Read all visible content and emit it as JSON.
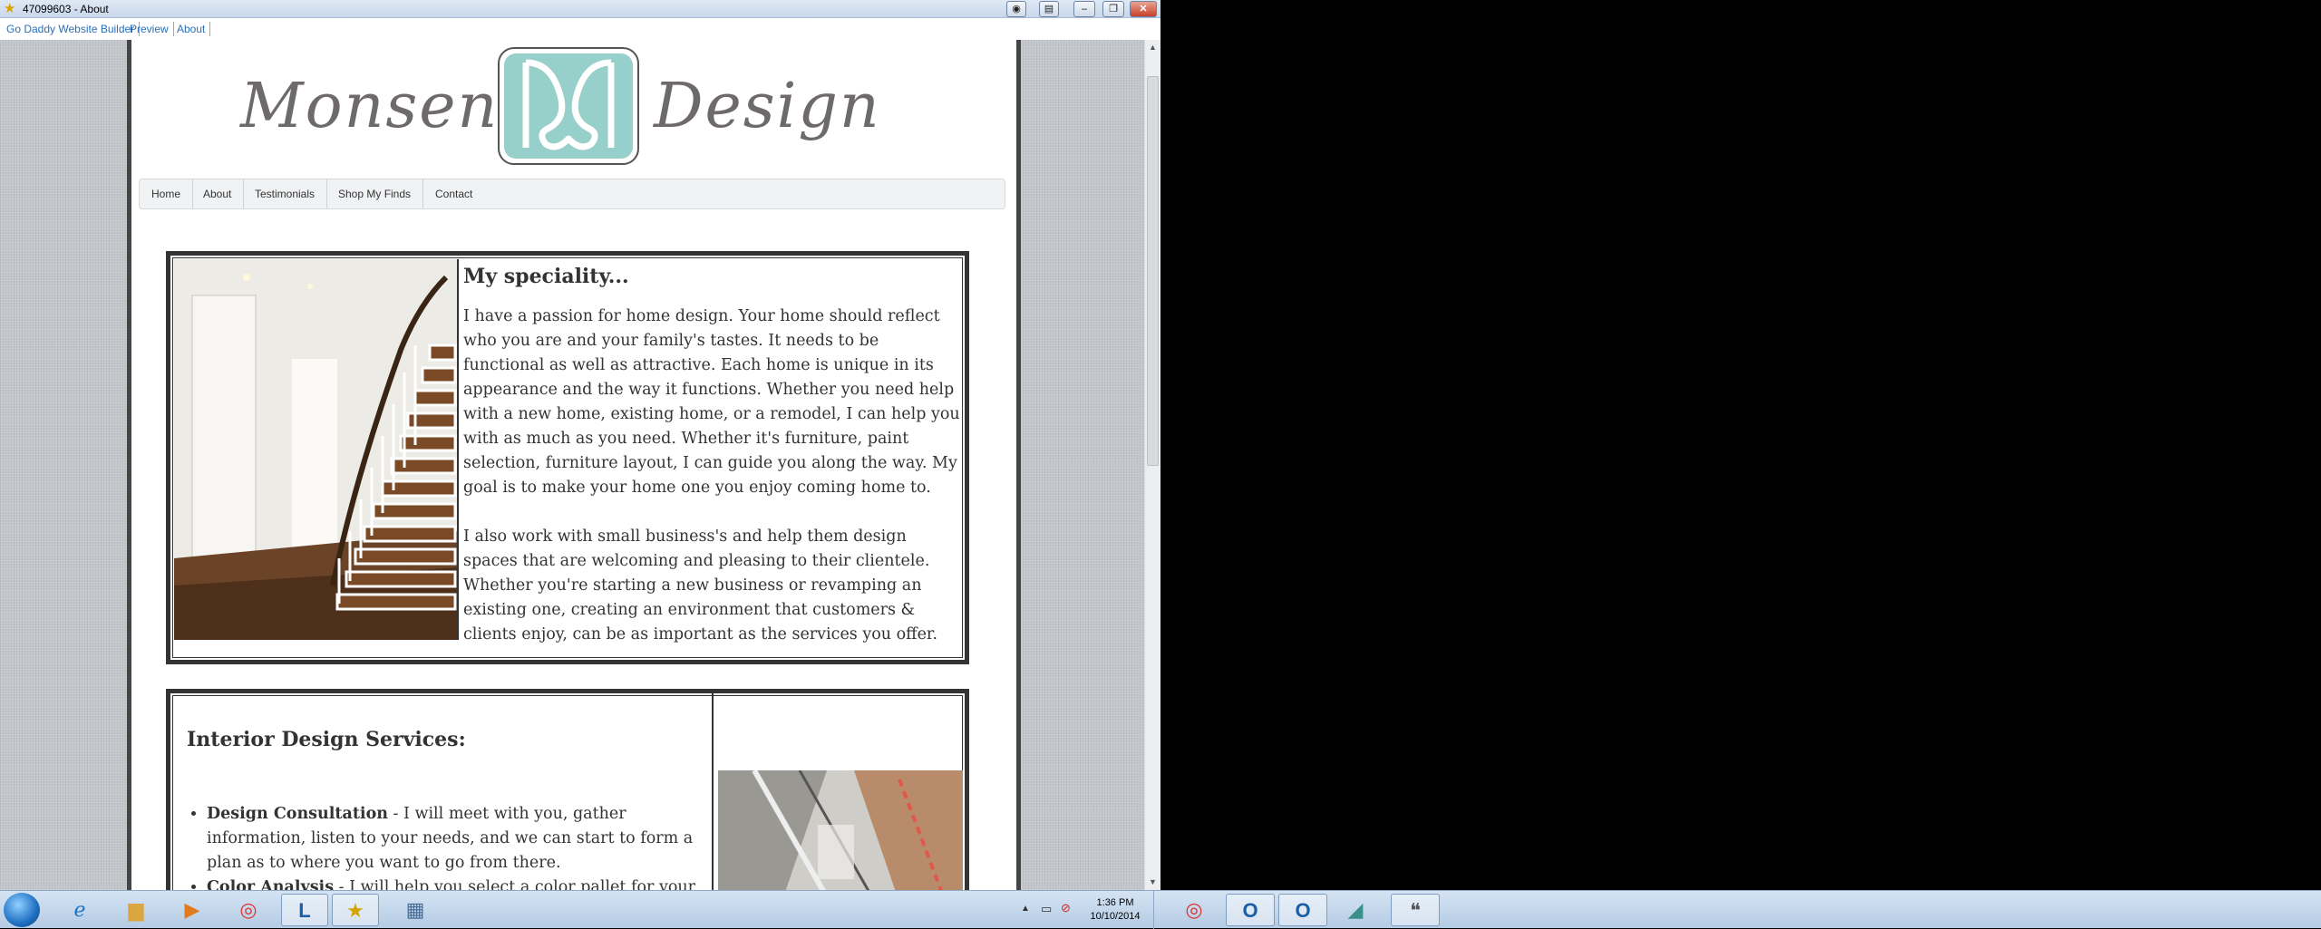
{
  "window": {
    "title": "47099603 - About"
  },
  "tabs": [
    "Go Daddy Website Builder",
    "Preview",
    "About"
  ],
  "site": {
    "logo_left": "Monsen",
    "logo_right": "Design",
    "nav": [
      "Home",
      "About",
      "Testimonials",
      "Shop My Finds",
      "Contact"
    ]
  },
  "speciality": {
    "heading": "My speciality...",
    "para1": "I have a passion for home design. Your home should reflect who you are and your family's tastes. It needs to be functional as well as attractive. Each home is unique in its appearance and the way it functions. Whether you need help with a new home, existing home, or a remodel, I can help you with as much as you need. Whether it's furniture, paint selection, furniture layout, I can guide you along the way. My goal is to make your home one you enjoy coming home to.",
    "para2": "I also work with small business's and help them design spaces that are welcoming and pleasing to their clientele. Whether you're starting a new business or revamping an existing one, creating an environment that customers & clients enjoy, can be as important as the services you offer."
  },
  "services": {
    "heading": "Interior Design Services:",
    "items": [
      {
        "title": "Design Consultation",
        "text": " - I will meet with you, gather information, listen to your needs, and we can start to form a plan as to where you want to go from there."
      },
      {
        "title": "Color Analysis",
        "text": " - I will help you select a color pallet for your"
      }
    ]
  },
  "taskbar": {
    "time": "1:36 PM",
    "date": "10/10/2014"
  },
  "icons": {
    "app": "star-icon",
    "start": "windows-start-icon"
  }
}
